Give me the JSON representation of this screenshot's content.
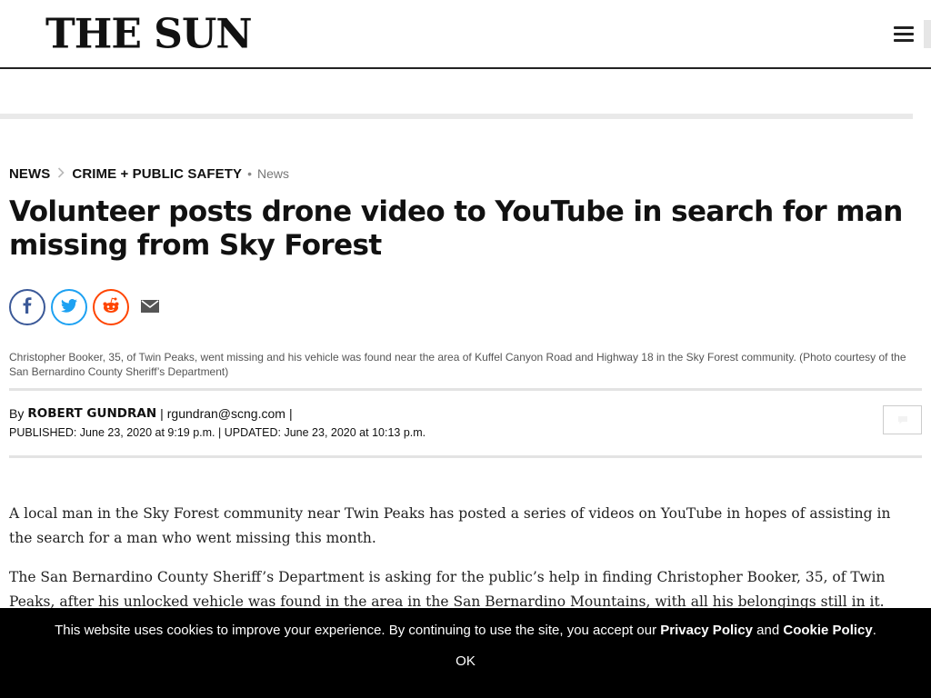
{
  "header": {
    "logo_text": "THE SUN",
    "menu_icon": "hamburger-menu-icon"
  },
  "breadcrumb": {
    "section": "NEWS",
    "subsection": "CRIME + PUBLIC SAFETY",
    "tag": "News",
    "separator_icon": "chevron-right-icon"
  },
  "article": {
    "headline": "Volunteer posts drone video to YouTube in search for man missing from Sky Forest",
    "share": {
      "facebook_icon": "facebook-icon",
      "twitter_icon": "twitter-icon",
      "reddit_icon": "reddit-icon",
      "email_icon": "email-icon"
    },
    "caption": "Christopher Booker, 35, of Twin Peaks, went missing and his vehicle was found near the area of Kuffel Canyon Road and Highway 18 in the Sky Forest community. (Photo courtesy of the San Bernardino County Sheriff’s Department)",
    "byline": {
      "by": "By",
      "author": "ROBERT GUNDRAN",
      "separator": "|",
      "email": "rgundran@scng.com",
      "trailing_separator": "|"
    },
    "dates": "PUBLISHED: June 23, 2020 at 9:19 p.m. | UPDATED: June 23, 2020 at 10:13 p.m.",
    "comment_icon": "comment-icon",
    "paragraphs": [
      "A local man in the Sky Forest community near Twin Peaks has posted a series of videos on YouTube in hopes of assisting in the search for a man who went missing this month.",
      "The San Bernardino County Sheriff’s Department is asking for the public’s help in finding Christopher Booker, 35, of Twin Peaks, after his unlocked vehicle was found in the area in the San Bernardino Mountains, with all his belongings still in it."
    ]
  },
  "cookie_banner": {
    "message": "This website uses cookies to improve your experience. By continuing to use the site, you accept our",
    "privacy_link": "Privacy Policy",
    "and": "and",
    "cookie_link": "Cookie Policy",
    "period": ".",
    "ok_label": "OK"
  },
  "colors": {
    "facebook": "#3b5998",
    "twitter": "#1da1f2",
    "reddit": "#ff4500",
    "cookie_bg": "#000000"
  }
}
